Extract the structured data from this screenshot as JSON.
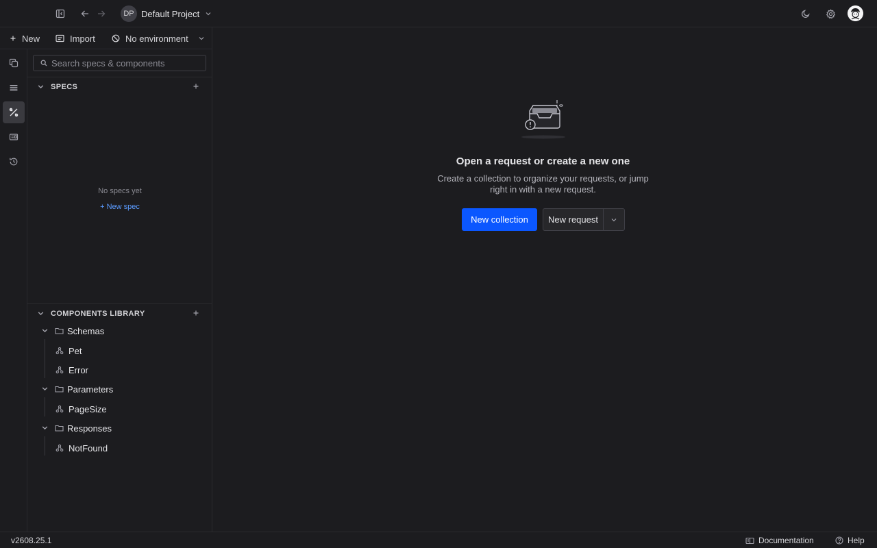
{
  "header": {
    "project_initials": "DP",
    "project_name": "Default Project"
  },
  "toolbar": {
    "new_label": "New",
    "import_label": "Import",
    "environment_label": "No environment"
  },
  "search": {
    "placeholder": "Search specs & components"
  },
  "specs": {
    "title": "SPECS",
    "empty_text": "No specs yet",
    "new_spec_label": "+ New spec"
  },
  "components": {
    "title": "COMPONENTS LIBRARY",
    "groups": [
      {
        "label": "Schemas",
        "items": [
          "Pet",
          "Error"
        ]
      },
      {
        "label": "Parameters",
        "items": [
          "PageSize"
        ]
      },
      {
        "label": "Responses",
        "items": [
          "NotFound"
        ]
      }
    ]
  },
  "main": {
    "title": "Open a request or create a new one",
    "subtitle": "Create a collection to organize your requests, or jump right in with a new request.",
    "new_collection_label": "New collection",
    "new_request_label": "New request"
  },
  "statusbar": {
    "version": "v2608.25.1",
    "documentation_label": "Documentation",
    "help_label": "Help"
  },
  "colors": {
    "background": "#1c1c1f",
    "accent": "#0b57ff",
    "link": "#5b9bff",
    "active_rail": "#3a3a3f"
  },
  "icons": {
    "sidebar_toggle": "sidebar-toggle-icon",
    "back": "arrow-left-icon",
    "forward": "arrow-right-icon",
    "theme": "moon-icon",
    "settings": "gear-icon",
    "collections": "copy-icon",
    "apis": "stack-icon",
    "specs": "tools-icon",
    "components": "id-card-icon",
    "history": "history-icon"
  }
}
